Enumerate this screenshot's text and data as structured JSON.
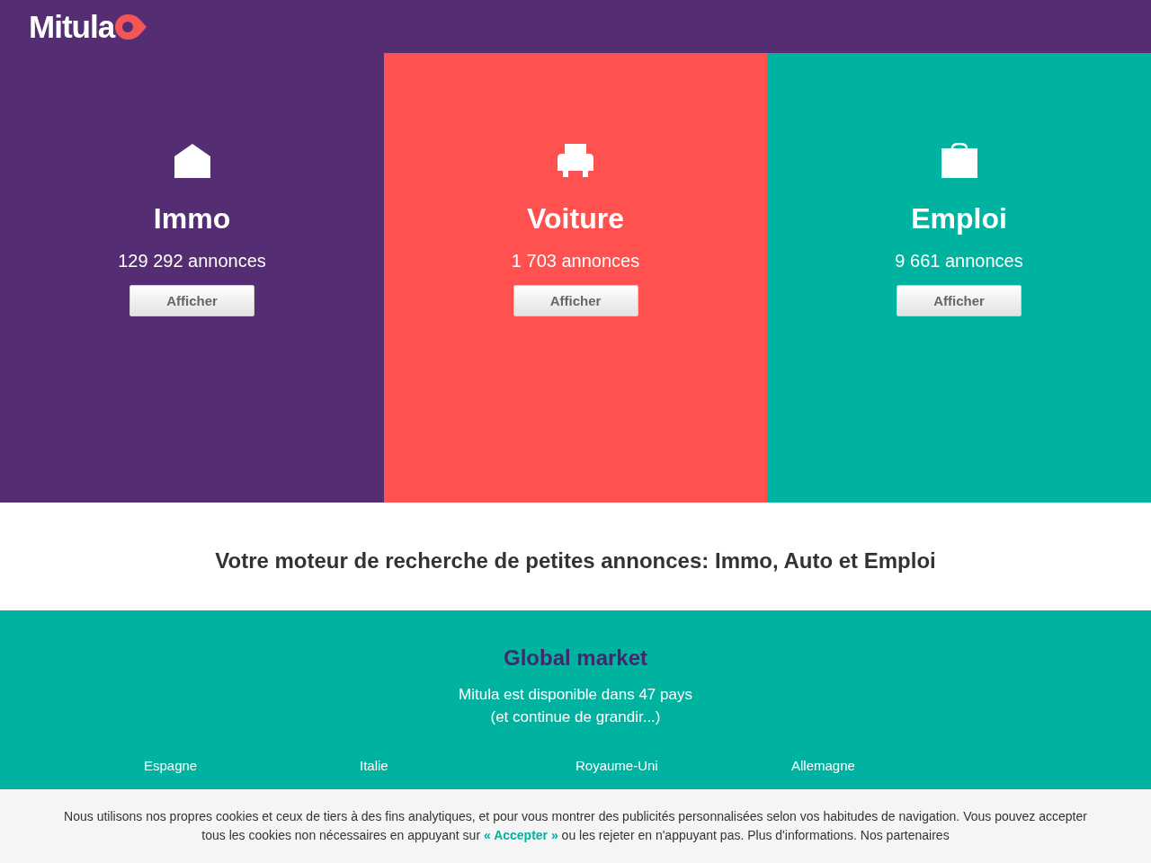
{
  "header": {
    "logo": "Mitula"
  },
  "categories": [
    {
      "kind": "house",
      "title": "Immo",
      "count": "129 292 annonces",
      "button": "Afficher",
      "color": "#552d73"
    },
    {
      "kind": "car",
      "title": "Voiture",
      "count": "1 703 annonces",
      "button": "Afficher",
      "color": "#fe5150"
    },
    {
      "kind": "briefcase",
      "title": "Emploi",
      "count": "9 661 annonces",
      "button": "Afficher",
      "color": "#00b3a0"
    }
  ],
  "tagline": "Votre moteur de recherche de petites annonces: Immo, Auto et Emploi",
  "global_market": {
    "title": "Global market",
    "lines": [
      "Mitula est disponible dans 47 pays",
      "(et continue de grandir...)"
    ],
    "countries": [
      "Espagne",
      "Italie",
      "Royaume-Uni",
      "Allemagne"
    ]
  },
  "cookie_banner": {
    "text_before": "Nous utilisons nos propres cookies et ceux de tiers à des fins analytiques, et pour vous montrer des publicités personnalisées selon vos habitudes de navigation. Vous pouvez accepter tous les cookies non nécessaires en appuyant sur ",
    "link": "« Accepter »",
    "text_after": " ou les rejeter en n'appuyant pas. Plus d'informations. Nos partenaires"
  }
}
